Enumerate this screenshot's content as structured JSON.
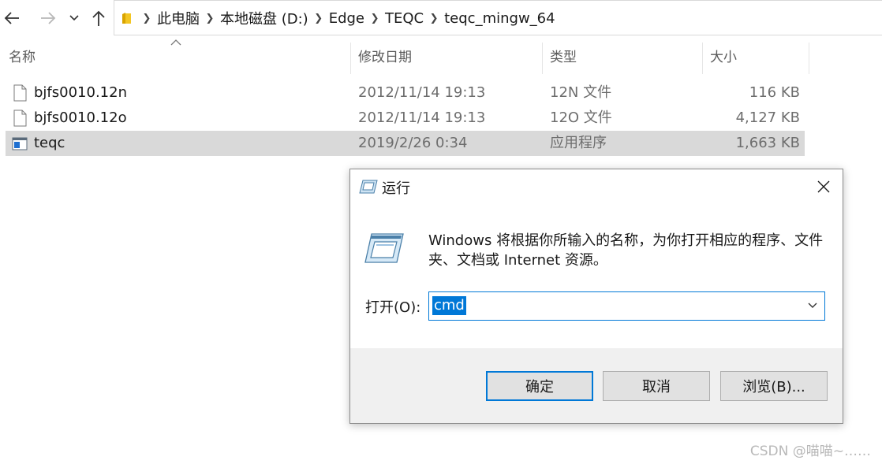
{
  "nav": {
    "back_icon": "arrow-left-icon",
    "forward_icon": "arrow-right-icon",
    "recent_icon": "chevron-down-icon",
    "up_icon": "arrow-up-icon"
  },
  "breadcrumb": [
    "此电脑",
    "本地磁盘 (D:)",
    "Edge",
    "TEQC",
    "teqc_mingw_64"
  ],
  "columns": {
    "name": "名称",
    "date": "修改日期",
    "type": "类型",
    "size": "大小"
  },
  "files": [
    {
      "name": "bjfs0010.12n",
      "date": "2012/11/14 19:13",
      "type": "12N 文件",
      "size": "116 KB",
      "icon": "file-icon"
    },
    {
      "name": "bjfs0010.12o",
      "date": "2012/11/14 19:13",
      "type": "12O 文件",
      "size": "4,127 KB",
      "icon": "file-icon"
    },
    {
      "name": "teqc",
      "date": "2019/2/26 0:34",
      "type": "应用程序",
      "size": "1,663 KB",
      "icon": "application-icon",
      "selected": true
    }
  ],
  "run_dialog": {
    "title": "运行",
    "description": "Windows 将根据你所输入的名称，为你打开相应的程序、文件夹、文档或 Internet 资源。",
    "open_label": "打开(O):",
    "open_value": "cmd",
    "ok_label": "确定",
    "cancel_label": "取消",
    "browse_label": "浏览(B)..."
  },
  "watermark": "CSDN @喵喵~……",
  "colors": {
    "accent": "#0078d7",
    "selection": "#d9d9d9",
    "footer": "#f0f0f0"
  }
}
